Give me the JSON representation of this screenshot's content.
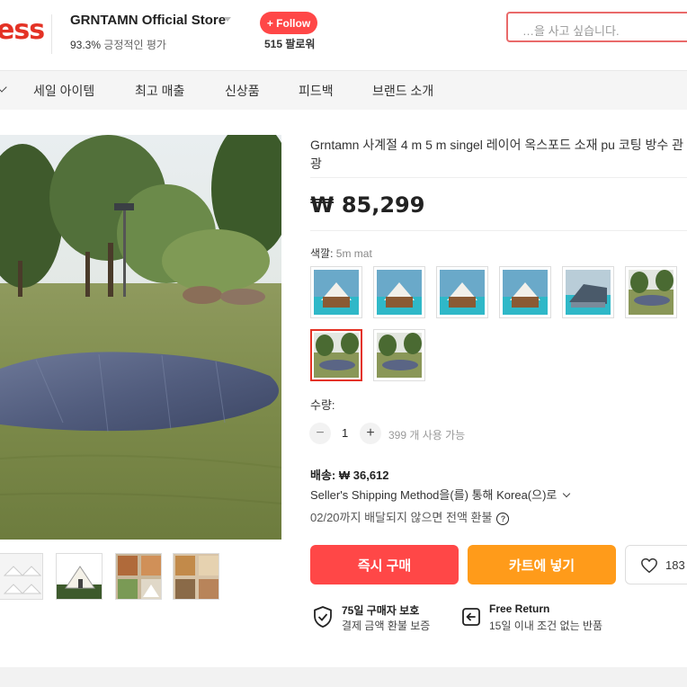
{
  "header": {
    "logo_text": "ess",
    "store_name": "GRNTAMN Official Store",
    "rating_value": "93.3%",
    "rating_text": "긍정적인 평가",
    "follow_label": "+ Follow",
    "followers_text": "515 팔로워",
    "search_placeholder": "…을 사고 싶습니다."
  },
  "nav": {
    "items": [
      "세일 아이템",
      "최고 매출",
      "신상품",
      "피드백",
      "브랜드 소개"
    ]
  },
  "product": {
    "title": "Grntamn 사계절 4 m 5 m singel 레이어 옥스포드 소재 pu 코팅 방수 관광",
    "price": "₩ 85,299",
    "color_label": "색깔:",
    "color_value": "5m mat",
    "quantity_label": "수량:",
    "quantity_value": "1",
    "quantity_minus": "−",
    "quantity_plus": "+",
    "available_text": "399 개 사용 가능",
    "shipping_cost": "배송: ₩ 36,612",
    "shipping_method": "Seller's Shipping Method을(를) 통해 Korea(으)로",
    "delivery_note": "02/20까지 배달되지 않으면 전액 환불",
    "buy_now_label": "즉시 구매",
    "add_to_cart_label": "카트에 넣기",
    "wishlist_count": "183"
  },
  "guarantees": [
    {
      "title": "75일 구매자 보호",
      "subtitle": "결제 금액 환불 보증"
    },
    {
      "title": "Free Return",
      "subtitle": "15일 이내 조건 없는 반품"
    }
  ],
  "colors": {
    "accent": "#ff4747",
    "cart": "#ff9b1a",
    "brand": "#e43225"
  }
}
